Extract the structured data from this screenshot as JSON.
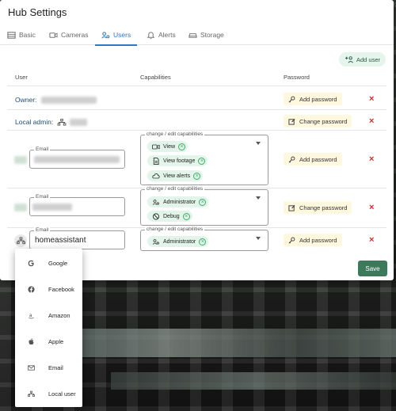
{
  "dialog": {
    "title": "Hub Settings"
  },
  "tabs": [
    {
      "label": "Basic",
      "icon": "list-icon"
    },
    {
      "label": "Cameras",
      "icon": "camera-icon"
    },
    {
      "label": "Users",
      "icon": "users-gear-icon",
      "active": true
    },
    {
      "label": "Alerts",
      "icon": "bell-icon"
    },
    {
      "label": "Storage",
      "icon": "drive-icon"
    }
  ],
  "toolbar": {
    "add_user_label": "Add user"
  },
  "table": {
    "headers": {
      "user": "User",
      "capabilities": "Capabilities",
      "password": "Password"
    },
    "owner": {
      "label": "Owner:",
      "password_button": "Add password"
    },
    "local_admin": {
      "label": "Local admin:",
      "password_button": "Change password"
    },
    "rows": [
      {
        "email_legend": "Email",
        "email_value": "",
        "capabilities_legend": "change / edit capabilities",
        "capabilities": [
          "View",
          "View footage",
          "View alerts"
        ],
        "password_button": "Add password"
      },
      {
        "email_legend": "Email",
        "email_value": "",
        "capabilities_legend": "change / edit capabilities",
        "capabilities": [
          "Administrator",
          "Debug"
        ],
        "password_button": "Change password"
      },
      {
        "email_legend": "Email",
        "email_value": "homeassistant",
        "capabilities_legend": "change / edit capabilities",
        "capabilities": [
          "Administrator"
        ],
        "password_button": "Add password"
      }
    ]
  },
  "footer": {
    "save_label": "Save"
  },
  "login_type_menu": {
    "items": [
      {
        "label": "Google",
        "icon": "google-icon"
      },
      {
        "label": "Facebook",
        "icon": "facebook-icon"
      },
      {
        "label": "Amazon",
        "icon": "amazon-icon"
      },
      {
        "label": "Apple",
        "icon": "apple-icon"
      },
      {
        "label": "Email",
        "icon": "email-icon"
      },
      {
        "label": "Local user",
        "icon": "network-icon"
      }
    ]
  },
  "colors": {
    "accent_blue": "#2c78c4",
    "save_green": "#3d7a5c",
    "chip_green": "#e3f4ea",
    "delete_red": "#d62a24",
    "password_button_bg": "#fff7de"
  }
}
